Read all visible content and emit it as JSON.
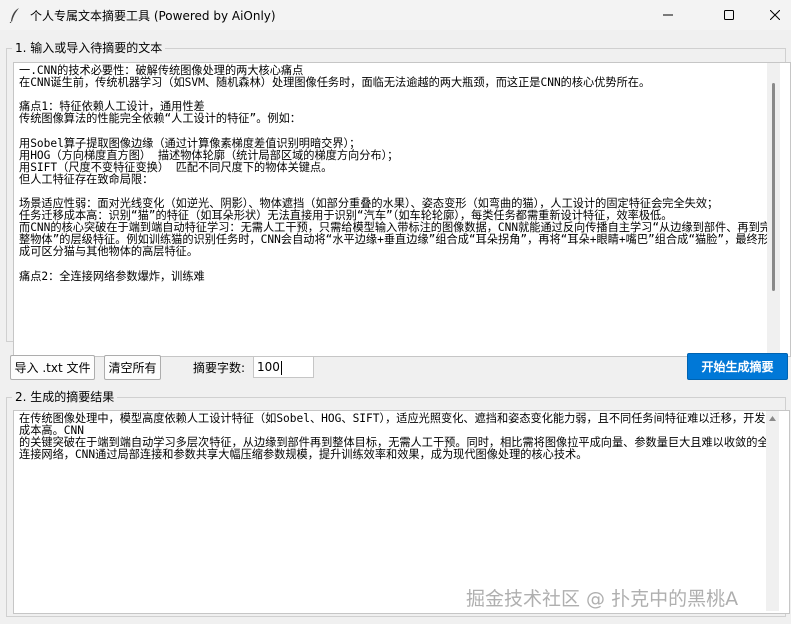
{
  "window": {
    "title": "个人专属文本摘要工具 (Powered by AiOnly)",
    "controls": [
      "minimize",
      "maximize",
      "close"
    ]
  },
  "input_section": {
    "label": "1. 输入或导入待摘要的文本",
    "text": "一.CNN的技术必要性：破解传统图像处理的两大核心痛点\n在CNN诞生前，传统机器学习（如SVM、随机森林）处理图像任务时，面临无法逾越的两大瓶颈，而这正是CNN的核心优势所在。\n\n痛点1：特征依赖人工设计，通用性差\n传统图像算法的性能完全依赖“人工设计的特征”。例如：\n\n用Sobel算子提取图像边缘（通过计算像素梯度差值识别明暗交界）；\n用HOG（方向梯度直方图） 描述物体轮廓（统计局部区域的梯度方向分布）；\n用SIFT（尺度不变特征变换） 匹配不同尺度下的物体关键点。\n但人工特征存在致命局限：\n\n场景适应性弱：面对光线变化（如逆光、阴影）、物体遮挡（如部分重叠的水果）、姿态变形（如弯曲的猫），人工设计的固定特征会完全失效；\n任务迁移成本高：识别“猫”的特征（如耳朵形状）无法直接用于识别“汽车”（如车轮轮廓），每类任务都需重新设计特征，效率极低。\n而CNN的核心突破在于端到端自动特征学习：无需人工干预，只需给模型输入带标注的图像数据，CNN就能通过反向传播自主学习“从边缘到部件、再到完整物体”的层级特征。例如训练猫的识别任务时，CNN会自动将“水平边缘+垂直边缘”组合成“耳朵拐角”，再将“耳朵+眼睛+嘴巴”组合成“猫脸”，最终形成可区分猫与其他物体的高层特征。\n\n痛点2：全连接网络参数爆炸，训练难"
  },
  "controls": {
    "import_button": "导入 .txt 文件",
    "clear_button": "清空所有",
    "length_label": "摘要字数:",
    "length_value": "100",
    "generate_button": "开始生成摘要"
  },
  "output_section": {
    "label": "2. 生成的摘要结果",
    "text": "在传统图像处理中，模型高度依赖人工设计特征（如Sobel、HOG、SIFT），适应光照变化、遮挡和姿态变化能力弱，且不同任务间特征难以迁移，开发成本高。CNN\n的关键突破在于端到端自动学习多层次特征，从边缘到部件再到整体目标，无需人工干预。同时，相比需将图像拉平成向量、参数量巨大且难以收敛的全连接网络，CNN通过局部连接和参数共享大幅压缩参数规模，提升训练效率和效果，成为现代图像处理的核心技术。"
  },
  "watermark": "掘金技术社区 @ 扑克中的黑桃A"
}
